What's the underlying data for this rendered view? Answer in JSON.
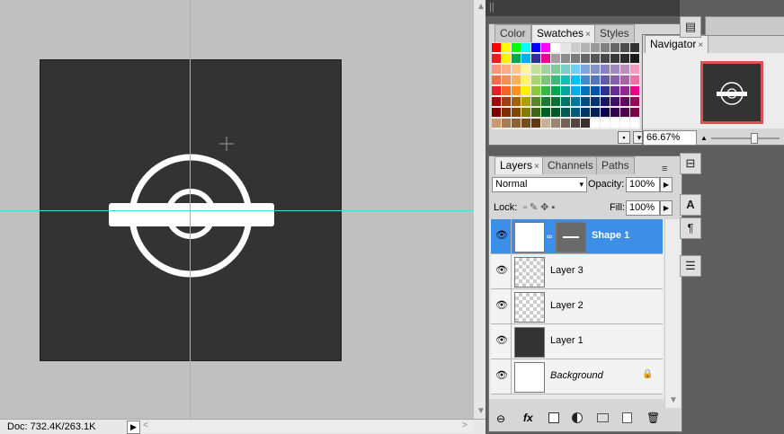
{
  "status": {
    "doc": "Doc: 732.4K/263.1K",
    "arrow": "▶",
    "scroll_left": "<",
    "scroll_right": ">"
  },
  "swatches_panel": {
    "tabs": [
      {
        "label": "Color"
      },
      {
        "label": "Swatches"
      },
      {
        "label": "Styles"
      }
    ],
    "close_glyph": "×",
    "menu_glyph": "≡",
    "rows": [
      [
        "#ff0000",
        "#ffff00",
        "#00ff00",
        "#00ffff",
        "#0000ff",
        "#ff00ff",
        "#ffffff",
        "#e6e6e6",
        "#cccccc",
        "#b3b3b3",
        "#999999",
        "#808080",
        "#666666",
        "#4d4d4d",
        "#333333"
      ],
      [
        "#ed1c24",
        "#fff200",
        "#00a651",
        "#00aeef",
        "#2e3192",
        "#ec008c",
        "#a0a0a0",
        "#8c8c8c",
        "#7a7a7a",
        "#666666",
        "#555555",
        "#474747",
        "#393939",
        "#2b2b2b",
        "#1a1a1a"
      ],
      [
        "#f7977a",
        "#f9ad81",
        "#fdc68a",
        "#fff79a",
        "#c4df9b",
        "#a3d39c",
        "#82ca9d",
        "#7bcdc8",
        "#6ecff6",
        "#7ea7d8",
        "#8493ca",
        "#8882be",
        "#a187be",
        "#bc8cbf",
        "#f49ac2"
      ],
      [
        "#f26c4f",
        "#f68e55",
        "#fbaf5c",
        "#fff467",
        "#acd372",
        "#7cc576",
        "#3bb878",
        "#1abbb4",
        "#00bff3",
        "#438ccb",
        "#5574b9",
        "#605ca8",
        "#855fa8",
        "#a763a8",
        "#f06ea9"
      ],
      [
        "#ed1c24",
        "#f26522",
        "#f7941d",
        "#fff200",
        "#8dc63f",
        "#39b54a",
        "#00a651",
        "#00a99d",
        "#00aeef",
        "#0072bc",
        "#0054a6",
        "#2e3192",
        "#662d91",
        "#92278f",
        "#ec008c"
      ],
      [
        "#9e0b0f",
        "#a0410d",
        "#a3620a",
        "#aba000",
        "#598527",
        "#1a7b30",
        "#007236",
        "#00746b",
        "#0076a3",
        "#004b80",
        "#003471",
        "#1b1464",
        "#440e62",
        "#630460",
        "#9e005d"
      ],
      [
        "#790000",
        "#7b2e00",
        "#7d4900",
        "#827b00",
        "#406618",
        "#005e20",
        "#005826",
        "#005952",
        "#005b7f",
        "#003663",
        "#002157",
        "#0d004c",
        "#32004b",
        "#4b0049",
        "#7b0046"
      ],
      [
        "#c69c6d",
        "#a67c52",
        "#8c6239",
        "#754c24",
        "#603913",
        "#c7b299",
        "#998675",
        "#736357",
        "#534741",
        "#37302d",
        "#ffffff",
        "#ffffff",
        "#ffffff",
        "#ffffff",
        "#ffffff"
      ]
    ]
  },
  "navigator_panel": {
    "tab": "Navigator",
    "zoom": "66.67%"
  },
  "layers_panel": {
    "tabs": [
      {
        "label": "Layers"
      },
      {
        "label": "Channels"
      },
      {
        "label": "Paths"
      }
    ],
    "blend_mode": "Normal",
    "opacity_label": "Opacity:",
    "opacity_value": "100%",
    "lock_label": "Lock:",
    "fill_label": "Fill:",
    "fill_value": "100%",
    "layers": [
      {
        "name": "Shape 1",
        "selected": true
      },
      {
        "name": "Layer 3",
        "selected": false
      },
      {
        "name": "Layer 2",
        "selected": false
      },
      {
        "name": "Layer 1",
        "selected": false
      },
      {
        "name": "Background",
        "selected": false
      }
    ],
    "bottom_icons": [
      "link-icon",
      "fx-icon",
      "mask-icon",
      "adjustment-icon",
      "group-folder-icon",
      "new-layer-icon",
      "trash-icon"
    ],
    "fx_label": "fx"
  },
  "colors": {
    "canvas_bg": "#333333",
    "pasteboard": "#c0c0c0",
    "guide": "#33e0e8",
    "selection": "#3d8ee7"
  },
  "right_toolbar": {
    "paragraph_glyph": "¶",
    "character_glyph": "A"
  }
}
